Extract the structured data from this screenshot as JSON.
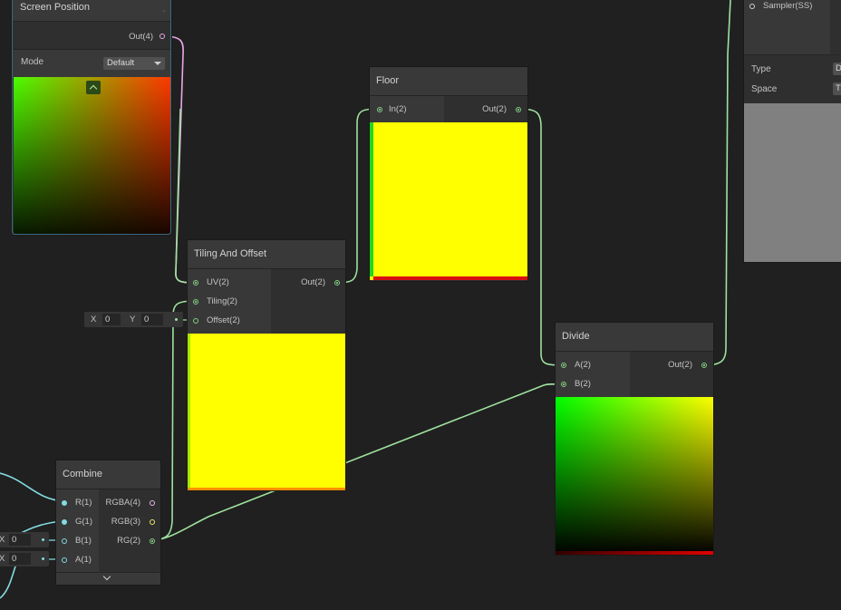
{
  "colors": {
    "background": "#202020",
    "wire_float2": "#9ee29e",
    "wire_float1": "#83dbe0",
    "wire_float4": "#e9a6e6",
    "selection_outline": "#3b6b80"
  },
  "screen_position": {
    "title": "Screen Position",
    "out_port": "Out(4)",
    "mode_label": "Mode",
    "mode_value": "Default",
    "collapse_icon": "chevron-up-icon"
  },
  "floor": {
    "title": "Floor",
    "in_port": "In(2)",
    "out_port": "Out(2)"
  },
  "tiling": {
    "title": "Tiling And Offset",
    "uv_port": "UV(2)",
    "tiling_port": "Tiling(2)",
    "offset_port": "Offset(2)",
    "out_port": "Out(2)",
    "offset_x_label": "X",
    "offset_x_value": "0",
    "offset_y_label": "Y",
    "offset_y_value": "0"
  },
  "divide": {
    "title": "Divide",
    "a_port": "A(2)",
    "b_port": "B(2)",
    "out_port": "Out(2)"
  },
  "combine": {
    "title": "Combine",
    "inputs": [
      "R(1)",
      "G(1)",
      "B(1)",
      "A(1)"
    ],
    "outputs": [
      "RGBA(4)",
      "RGB(3)",
      "RG(2)"
    ],
    "b_x_label": "X",
    "b_x_value": "0",
    "a_x_label": "X",
    "a_x_value": "0",
    "expand_icon": "chevron-down-icon"
  },
  "sampler": {
    "port": "Sampler(SS)",
    "type_label": "Type",
    "type_value": "D",
    "space_label": "Space",
    "space_value": "T"
  }
}
